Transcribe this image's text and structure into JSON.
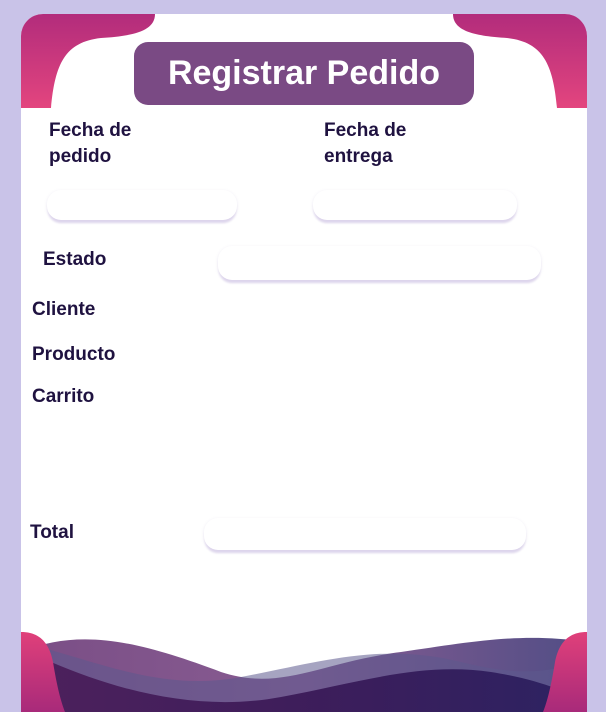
{
  "form": {
    "title": "Registrar Pedido",
    "fecha_pedido_label": "Fecha de pedido",
    "fecha_entrega_label": "Fecha de entrega",
    "estado_label": "Estado",
    "cliente_label": "Cliente",
    "producto_label": "Producto",
    "carrito_label": "Carrito",
    "total_label": "Total",
    "fecha_pedido_value": "",
    "fecha_entrega_value": "",
    "estado_value": "",
    "total_value": ""
  },
  "colors": {
    "background": "#c9c3e8",
    "card": "#ffffff",
    "title_bg": "#7a4a84",
    "accent_pink": "#e0407a",
    "accent_magenta": "#b8307e",
    "wave_purple": "#5e2a6e",
    "label_text": "#1f1240"
  }
}
